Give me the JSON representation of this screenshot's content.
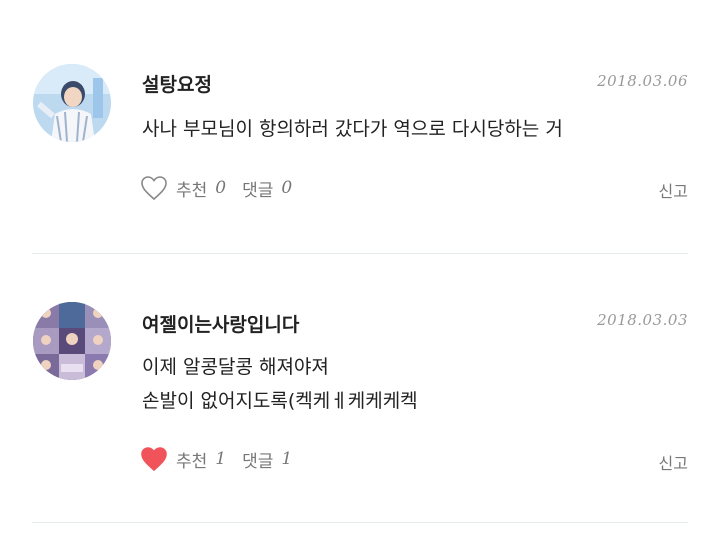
{
  "comments": [
    {
      "username": "설탕요정",
      "date": "2018.03.06",
      "lines": [
        "사나 부모님이 항의하러 갔다가 역으로 다시당하는 거"
      ],
      "like_label": "추천",
      "like_count": "0",
      "reply_label": "댓글",
      "reply_count": "0",
      "report": "신고",
      "liked": false
    },
    {
      "username": "여젤이는사랑입니다",
      "date": "2018.03.03",
      "lines": [
        "이제 알콩달콩 해져야져",
        "손발이 없어지도록(켁케ㅔ케케케켁"
      ],
      "like_label": "추천",
      "like_count": "1",
      "reply_label": "댓글",
      "reply_count": "1",
      "report": "신고",
      "liked": true
    }
  ],
  "colors": {
    "heart_filled": "#f0545a",
    "heart_outline": "#888888",
    "divider": "#e6ece8"
  }
}
